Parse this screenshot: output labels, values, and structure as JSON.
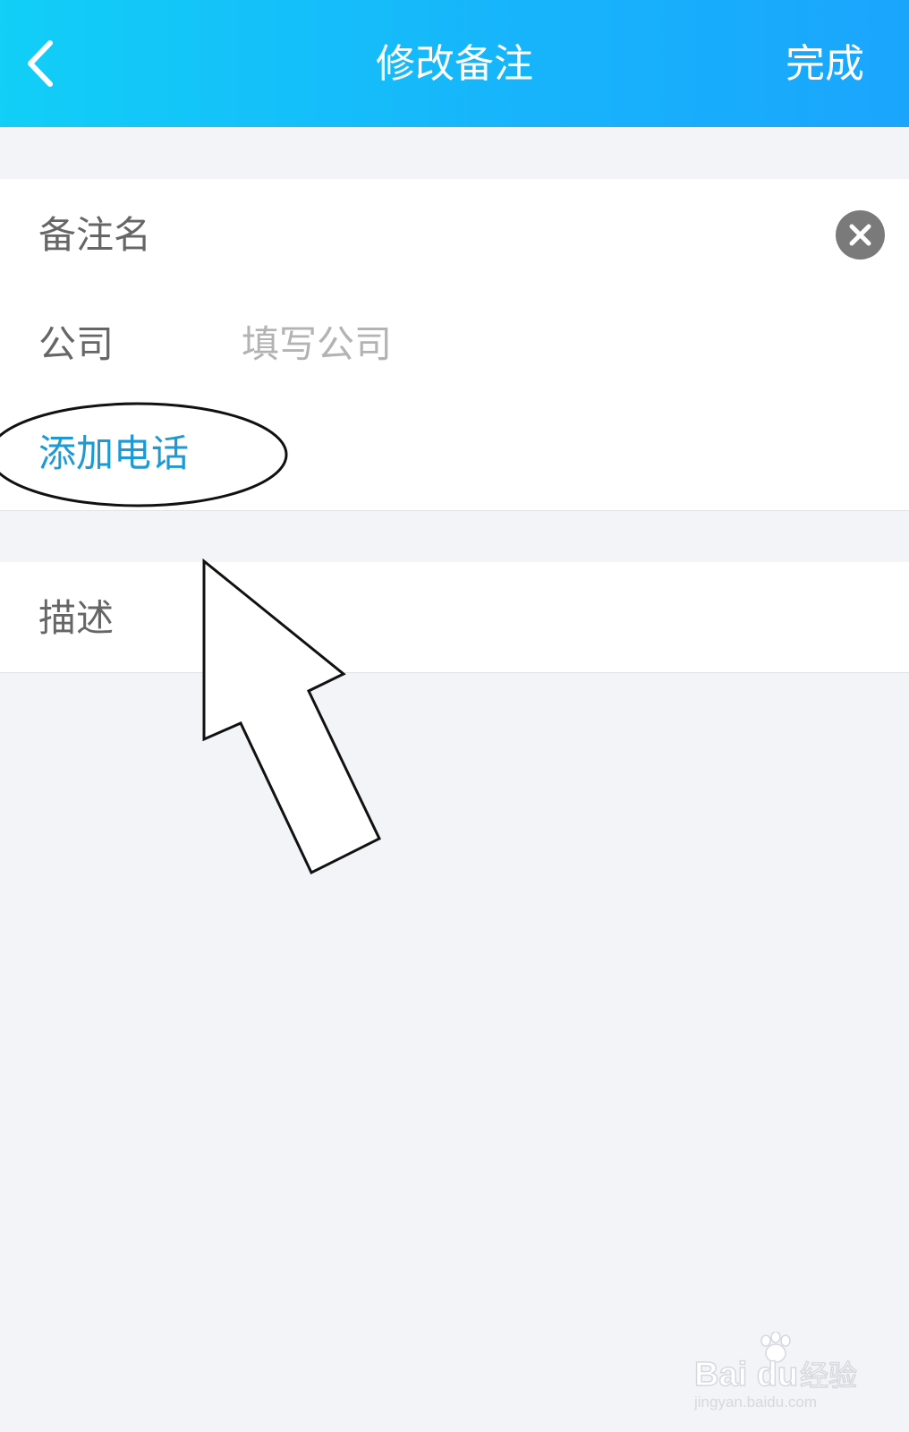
{
  "header": {
    "title": "修改备注",
    "done_label": "完成",
    "gradient": [
      "#11cff7",
      "#1aa5fd"
    ]
  },
  "form": {
    "remark_name_label": "备注名",
    "company_label": "公司",
    "company_placeholder": "填写公司",
    "add_phone_label": "添加电话",
    "description_label": "描述"
  },
  "colors": {
    "link": "#1d9ad4",
    "label": "#666666",
    "placeholder": "#b3b3b3",
    "background": "#f3f4f8"
  },
  "watermark": {
    "brand": "Bai du 经验",
    "url": "jingyan.baidu.com"
  }
}
